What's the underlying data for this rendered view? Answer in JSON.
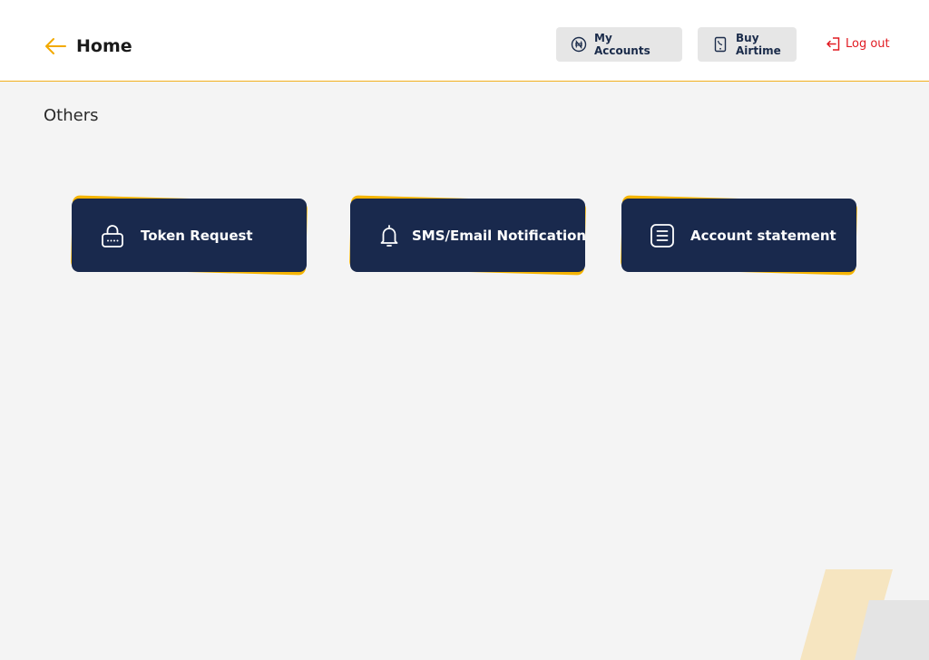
{
  "header": {
    "title": "Home",
    "back_icon": "arrow-left-icon",
    "my_accounts_label": "My Accounts",
    "buy_airtime_label": "Buy Airtime",
    "logout_label": "Log out"
  },
  "section": {
    "title": "Others"
  },
  "cards": [
    {
      "label": "Token Request",
      "icon": "lock-icon"
    },
    {
      "label": "SMS/Email Notification",
      "icon": "bell-icon"
    },
    {
      "label": "Account statement",
      "icon": "document-icon"
    }
  ],
  "colors": {
    "accent": "#f5b400",
    "card_bg": "#19294d",
    "logout": "#e11b22",
    "page_bg": "#f4f4f4"
  }
}
